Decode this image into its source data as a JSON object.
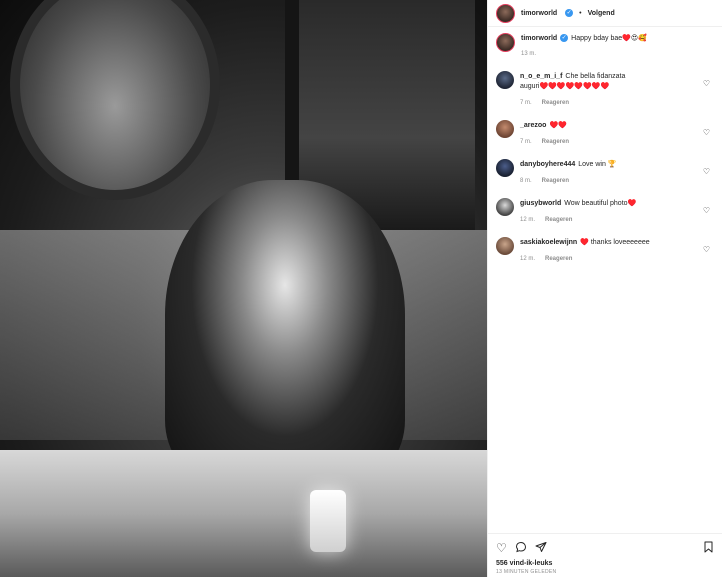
{
  "post": {
    "username": "timorworld",
    "follow_label": "Volgend",
    "dot": "•",
    "verified_mark": "✓",
    "caption": "Happy bday bae♥️😍🥰",
    "caption_time": "13 m."
  },
  "comments": [
    {
      "user": "n_o_e_m_i_f",
      "text": "Che bella fidanzata auguri♥️♥️♥️♥️♥️♥️♥️♥️",
      "time": "7 m.",
      "reply": "Reageren",
      "avatar": "av1"
    },
    {
      "user": "_arezoo",
      "text": "♥️♥️",
      "time": "7 m.",
      "reply": "Reageren",
      "avatar": "av2"
    },
    {
      "user": "danyboyhere444",
      "text": "Love win 🏆",
      "time": "8 m.",
      "reply": "Reageren",
      "avatar": "av3"
    },
    {
      "user": "giusybworld",
      "text": "Wow beautiful photo♥️",
      "time": "12 m.",
      "reply": "Reageren",
      "avatar": "av4"
    },
    {
      "user": "saskiakoelewijnn",
      "text": "♥️ thanks loveeeeeee",
      "time": "12 m.",
      "reply": "Reageren",
      "avatar": "av5"
    }
  ],
  "actions": {
    "like_icon": "heart-outline",
    "comment_icon": "speech-bubble",
    "share_icon": "paper-plane",
    "save_icon": "bookmark",
    "likes": "556 vind-ik-leuks",
    "posted": "13 MINUTEN GELEDEN"
  },
  "colors": {
    "accent_ring": "#e4405f",
    "verified": "#3897f0",
    "muted": "#8e8e8e"
  }
}
